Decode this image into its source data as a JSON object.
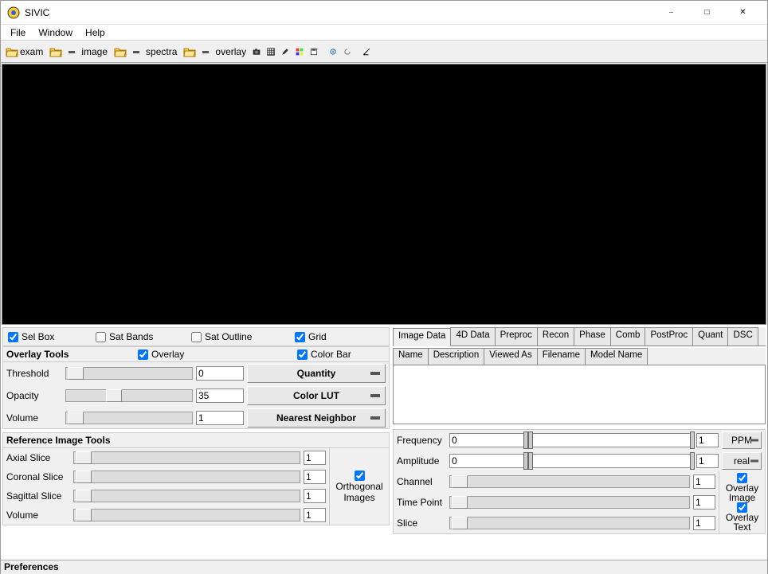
{
  "window": {
    "title": "SIVIC"
  },
  "menu": {
    "file": "File",
    "window": "Window",
    "help": "Help"
  },
  "toolbar": {
    "exam": "exam",
    "image": "image",
    "spectra": "spectra",
    "overlay": "overlay"
  },
  "view_options": {
    "selbox": "Sel Box",
    "satbands": "Sat Bands",
    "satoutline": "Sat Outline",
    "grid": "Grid"
  },
  "overlay_tools": {
    "title": "Overlay Tools",
    "overlay_chk": "Overlay",
    "colorbar_chk": "Color Bar",
    "threshold": {
      "label": "Threshold",
      "value": "0"
    },
    "opacity": {
      "label": "Opacity",
      "value": "35"
    },
    "volume": {
      "label": "Volume",
      "value": "1"
    },
    "quantity_btn": "Quantity",
    "colorlut_btn": "Color LUT",
    "interp_btn": "Nearest Neighbor"
  },
  "ref_tools": {
    "title": "Reference Image Tools",
    "axial": {
      "label": "Axial Slice",
      "value": "1"
    },
    "coronal": {
      "label": "Coronal Slice",
      "value": "1"
    },
    "sagittal": {
      "label": "Sagittal Slice",
      "value": "1"
    },
    "volume": {
      "label": "Volume",
      "value": "1"
    },
    "orthogonal": "Orthogonal Images"
  },
  "right_tabs": [
    "Image Data",
    "4D Data",
    "Preproc",
    "Recon",
    "Phase",
    "Comb",
    "PostProc",
    "Quant",
    "DSC"
  ],
  "right_subtabs": [
    "Name",
    "Description",
    "Viewed As",
    "Filename",
    "Model Name"
  ],
  "right_sliders": {
    "frequency": {
      "label": "Frequency",
      "lo": "0",
      "hi": "1",
      "unit": "PPM"
    },
    "amplitude": {
      "label": "Amplitude",
      "lo": "0",
      "hi": "1",
      "unit": "real"
    },
    "channel": {
      "label": "Channel",
      "value": "1"
    },
    "timepoint": {
      "label": "Time Point",
      "value": "1"
    },
    "slice": {
      "label": "Slice",
      "value": "1"
    },
    "overlay_image": "Overlay Image",
    "overlay_text": "Overlay Text"
  },
  "statusbar": "Preferences"
}
